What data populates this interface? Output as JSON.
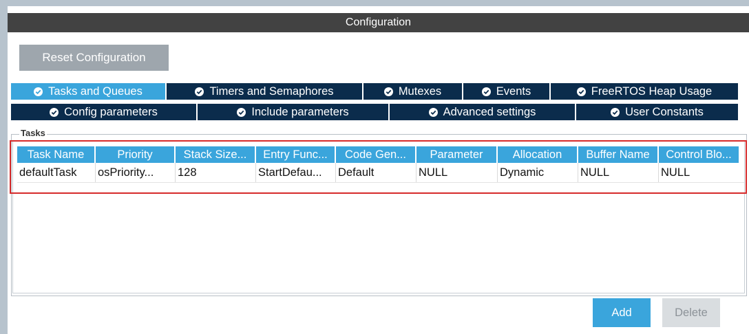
{
  "header": {
    "title": "Configuration"
  },
  "toolbar": {
    "reset_label": "Reset Configuration"
  },
  "tabs_row1": [
    {
      "label": "Tasks and Queues",
      "active": true
    },
    {
      "label": "Timers and Semaphores",
      "active": false
    },
    {
      "label": "Mutexes",
      "active": false
    },
    {
      "label": "Events",
      "active": false
    },
    {
      "label": "FreeRTOS Heap Usage",
      "active": false
    }
  ],
  "tabs_row2": [
    {
      "label": "Config parameters"
    },
    {
      "label": "Include parameters"
    },
    {
      "label": "Advanced settings"
    },
    {
      "label": "User Constants"
    }
  ],
  "tasks": {
    "legend": "Tasks",
    "columns": [
      "Task Name",
      "Priority",
      "Stack Size...",
      "Entry Func...",
      "Code Gen...",
      "Parameter",
      "Allocation",
      "Buffer Name",
      "Control Blo..."
    ],
    "rows": [
      [
        "defaultTask",
        "osPriority...",
        "128",
        "StartDefau...",
        "Default",
        "NULL",
        "Dynamic",
        "NULL",
        "NULL"
      ]
    ]
  },
  "buttons": {
    "add_label": "Add",
    "delete_label": "Delete"
  },
  "colors": {
    "accent": "#3aa5dc",
    "tab_dark": "#0b2c4c",
    "header_dark": "#424242",
    "highlight_red": "#d62a2a"
  },
  "icons": {
    "tab_check": "check-circle-icon"
  }
}
